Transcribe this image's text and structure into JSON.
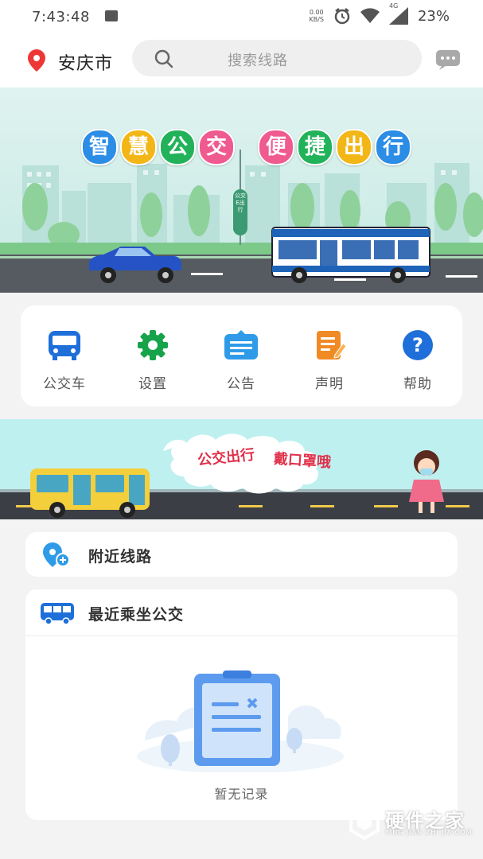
{
  "status_bar": {
    "time": "7:43:48",
    "net_speed_value": "0.00",
    "net_speed_unit": "KB/S",
    "network": "4G",
    "battery": "23%"
  },
  "header": {
    "city": "安庆市",
    "search_placeholder": "搜索线路"
  },
  "banner": {
    "slogan_left": [
      "智",
      "慧",
      "公",
      "交"
    ],
    "slogan_right": [
      "便",
      "捷",
      "出",
      "行"
    ],
    "sign_text": "公交E出行"
  },
  "menu": [
    {
      "label": "公交车",
      "icon": "bus-icon",
      "color": "#1e6fd9"
    },
    {
      "label": "设置",
      "icon": "gear-icon",
      "color": "#16a34a"
    },
    {
      "label": "公告",
      "icon": "notice-icon",
      "color": "#2f9be8"
    },
    {
      "label": "声明",
      "icon": "statement-icon",
      "color": "#f08a24"
    },
    {
      "label": "帮助",
      "icon": "help-icon",
      "color": "#1e6fd9"
    }
  ],
  "banner2": {
    "text_a": "公交出行",
    "text_b": "戴口罩哦"
  },
  "nearby": {
    "title": "附近线路"
  },
  "recent": {
    "title": "最近乘坐公交",
    "empty_text": "暂无记录"
  },
  "watermark": {
    "title": "硬件之家",
    "subtitle": "YING JIAN ZHI JIA.COM"
  }
}
